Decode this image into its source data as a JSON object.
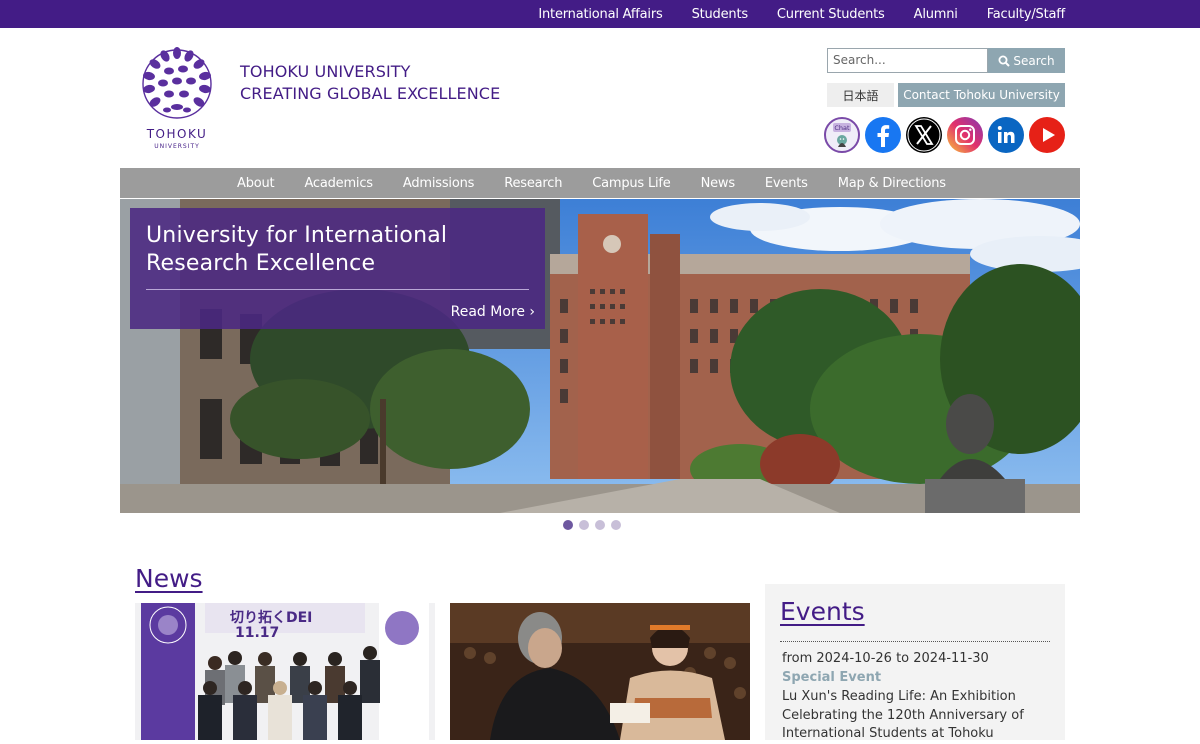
{
  "colors": {
    "brand_purple": "#431c86",
    "nav_gray": "#9c9c9c",
    "button_steel": "#8ea6b1"
  },
  "topnav": [
    "International Affairs",
    "Students",
    "Current Students",
    "Alumni",
    "Faculty/Staff"
  ],
  "header": {
    "logo_word": "TOHOKU",
    "logo_sub": "UNIVERSITY",
    "title_line1": "TOHOKU UNIVERSITY",
    "title_line2": "CREATING GLOBAL EXCELLENCE"
  },
  "search": {
    "placeholder": "Search...",
    "button_label": "Search"
  },
  "language_button": "日本語",
  "contact_button": "Contact Tohoku University",
  "social": {
    "chat_label": "Chat",
    "icons": [
      "chat-icon",
      "facebook-icon",
      "x-icon",
      "instagram-icon",
      "linkedin-icon",
      "youtube-icon"
    ]
  },
  "mainnav": [
    "About",
    "Academics",
    "Admissions",
    "Research",
    "Campus Life",
    "News",
    "Events",
    "Map & Directions"
  ],
  "hero": {
    "title_line1": "University for International",
    "title_line2": "Research Excellence",
    "read_more": "Read More ›",
    "slide_count": 4,
    "active_slide": 1
  },
  "news": {
    "heading": "News",
    "item1": {
      "banner_text": "切り拓くDEI",
      "banner_date": "11.17"
    }
  },
  "events": {
    "heading": "Events",
    "item": {
      "date": "from 2024-10-26 to 2024-11-30",
      "type": "Special Event",
      "title": "Lu Xun's Reading Life: An Exhibition Celebrating the 120th Anniversary of International Students at Tohoku"
    }
  }
}
